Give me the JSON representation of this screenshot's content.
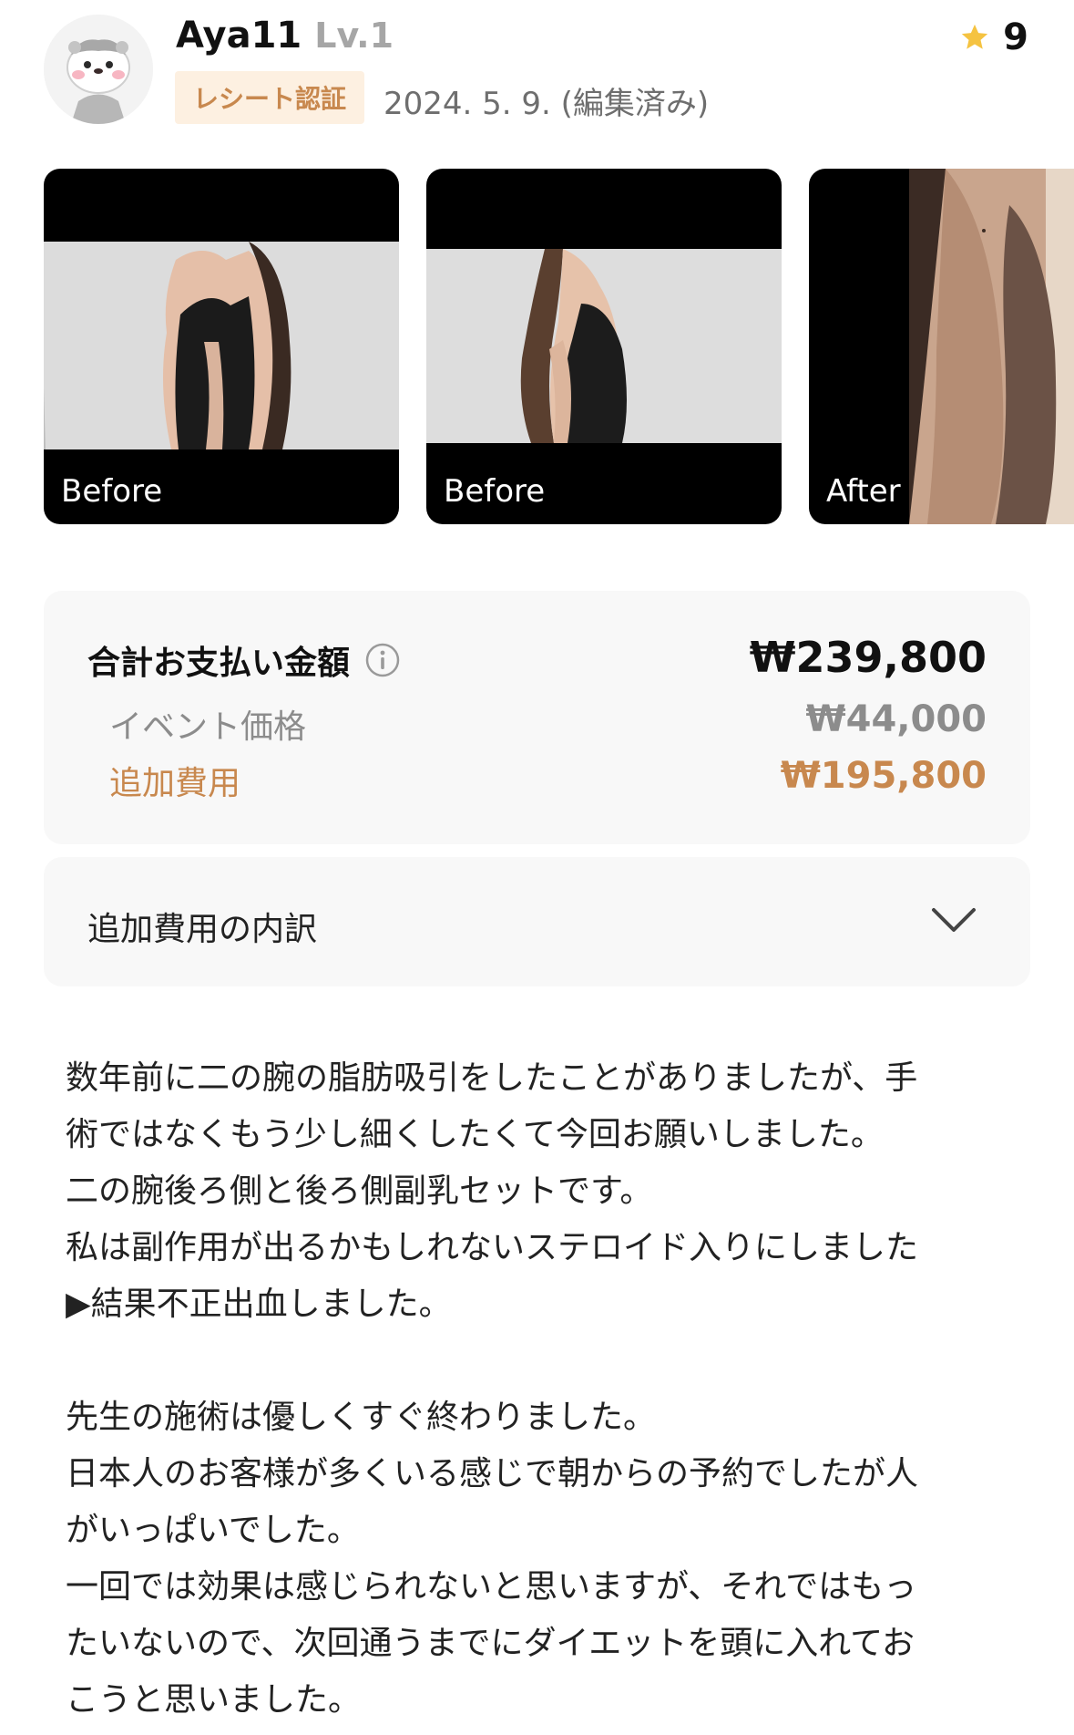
{
  "header": {
    "username": "Aya11",
    "level": "Lv.1",
    "rating": "9",
    "badge": "レシート認証",
    "date": "2024. 5. 9. (編集済み)"
  },
  "photos": [
    {
      "label": "Before"
    },
    {
      "label": "Before"
    },
    {
      "label": "After"
    }
  ],
  "payment": {
    "total_label": "合計お支払い金額",
    "total_value": "₩239,800",
    "event_label": "イベント価格",
    "event_value": "₩44,000",
    "extra_label": "追加費用",
    "extra_value": "₩195,800"
  },
  "breakdown": {
    "label": "追加費用の内訳"
  },
  "review_lines": [
    "数年前に二の腕の脂肪吸引をしたことがありましたが、手",
    "術ではなくもう少し細くしたくて今回お願いしました。",
    "二の腕後ろ側と後ろ側副乳セットです。",
    "私は副作用が出るかもしれないステロイド入りにしました",
    "▶結果不正出血しました。",
    "",
    "先生の施術は優しくすぐ終わりました。",
    "日本人のお客様が多くいる感じで朝からの予約でしたが人",
    "がいっぱいでした。",
    "一回では効果は感じられないと思いますが、それではもっ",
    "たいないので、次回通うまでにダイエットを頭に入れてお",
    "こうと思いました。"
  ],
  "colors": {
    "accent": "#c8884e",
    "badge_bg": "#fdf0e1",
    "star": "#f5c341",
    "panel_bg": "#f8f8f8"
  },
  "icons": {
    "rating": "star-icon",
    "info": "info-icon",
    "expand": "chevron-down-icon"
  }
}
